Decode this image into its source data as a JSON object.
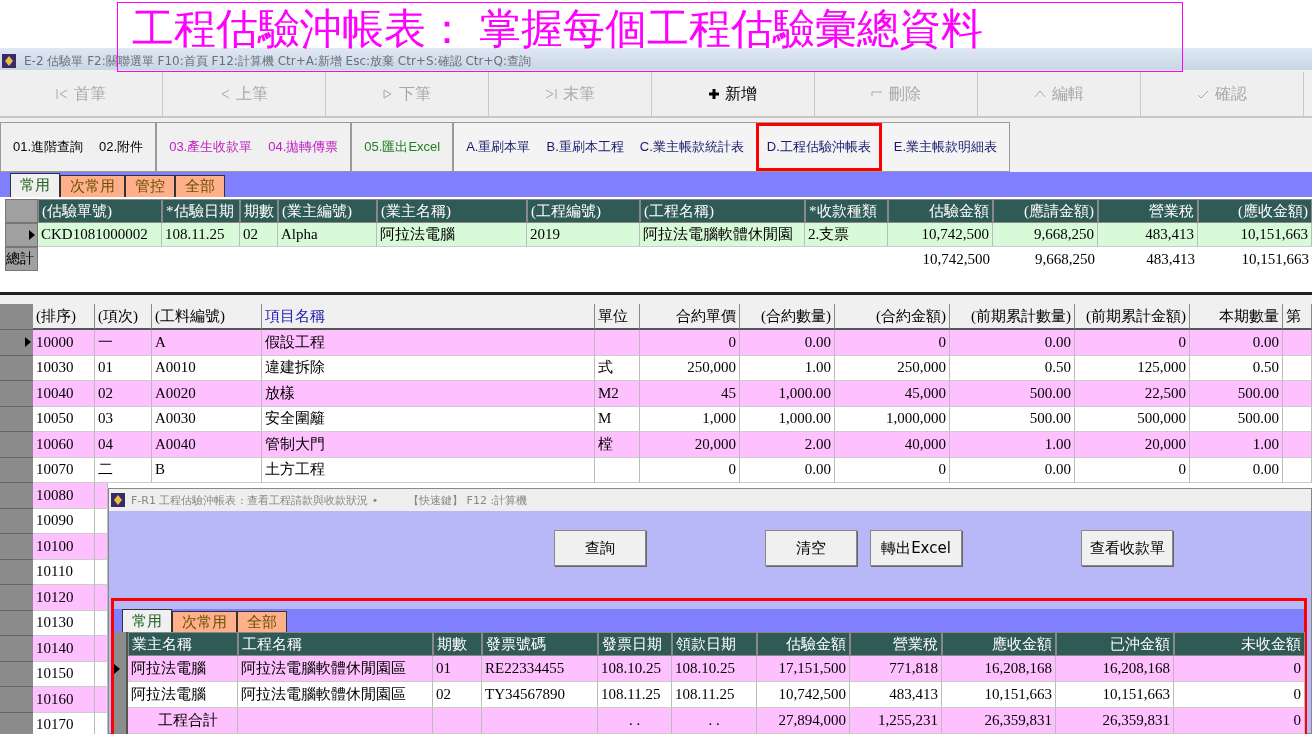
{
  "banner": {
    "title": "工程估驗沖帳表： 掌握每個工程估驗彙總資料"
  },
  "window": {
    "title": "E-2 估驗單 F2:關聯選單 F10:首頁 F12:計算機 Ctr+A:新增 Esc:放棄 Ctr+S:確認 Ctr+Q:查詢"
  },
  "toolbar": [
    {
      "label": "首筆",
      "kind": "first",
      "disabled": true
    },
    {
      "label": "上筆",
      "kind": "prev",
      "disabled": true
    },
    {
      "label": "下筆",
      "kind": "next",
      "disabled": true
    },
    {
      "label": "末筆",
      "kind": "last",
      "disabled": true
    },
    {
      "label": "新增",
      "kind": "add",
      "disabled": false
    },
    {
      "label": "刪除",
      "kind": "delete",
      "disabled": true
    },
    {
      "label": "編輯",
      "kind": "edit",
      "disabled": true
    },
    {
      "label": "確認",
      "kind": "confirm",
      "disabled": true
    }
  ],
  "actions": [
    {
      "items": [
        {
          "label": "01.進階查詢",
          "color": "#000000",
          "highlighted": false
        },
        {
          "label": "02.附件",
          "color": "#000000",
          "highlighted": false
        }
      ]
    },
    {
      "items": [
        {
          "label": "03.產生收款單",
          "color": "#c020c0",
          "highlighted": false
        },
        {
          "label": "04.拋轉傳票",
          "color": "#c020c0",
          "highlighted": false
        }
      ]
    },
    {
      "items": [
        {
          "label": "05.匯出Excel",
          "color": "#208020",
          "highlighted": false
        }
      ]
    },
    {
      "items": [
        {
          "label": "A.重刷本單",
          "color": "#1a1a6e",
          "highlighted": false
        },
        {
          "label": "B.重刷本工程",
          "color": "#1a1a6e",
          "highlighted": false
        },
        {
          "label": "C.業主帳款統計表",
          "color": "#1a1a6e",
          "highlighted": false
        },
        {
          "label": "D.工程估驗沖帳表",
          "color": "#1a1a6e",
          "highlighted": true
        },
        {
          "label": "E.業主帳款明細表",
          "color": "#1a1a6e",
          "highlighted": false
        }
      ]
    }
  ],
  "tabs": [
    {
      "label": "常用",
      "selected": true
    },
    {
      "label": "次常用",
      "selected": false
    },
    {
      "label": "管控",
      "selected": false
    },
    {
      "label": "全部",
      "selected": false
    }
  ],
  "upper_grid": {
    "columns": [
      "(估驗單號)",
      "*估驗日期",
      "期數",
      "(業主編號)",
      "(業主名稱)",
      "(工程編號)",
      "(工程名稱)",
      "*收款種類",
      "估驗金額",
      "(應請金額)",
      "營業稅",
      "(應收金額)"
    ],
    "rows": [
      {
        "current": true,
        "cells": [
          "CKD1081000002",
          "108.11.25",
          "02",
          "Alpha",
          "阿拉法電腦",
          "2019",
          "阿拉法電腦軟體休閒園",
          "2.支票",
          "10,742,500",
          "9,668,250",
          "483,413",
          "10,151,663"
        ]
      }
    ],
    "totals": {
      "label": "總計",
      "amounts": [
        "10,742,500",
        "9,668,250",
        "483,413",
        "10,151,663"
      ]
    }
  },
  "lower_grid": {
    "columns": [
      {
        "label": "(排序)",
        "emphasis": false
      },
      {
        "label": "(項次)",
        "emphasis": false
      },
      {
        "label": "(工料編號)",
        "emphasis": false
      },
      {
        "label": "項目名稱",
        "emphasis": true
      },
      {
        "label": "單位",
        "emphasis": false
      },
      {
        "label": "合約單價",
        "emphasis": false
      },
      {
        "label": "(合約數量)",
        "emphasis": false
      },
      {
        "label": "(合約金額)",
        "emphasis": false
      },
      {
        "label": "(前期累計數量)",
        "emphasis": false
      },
      {
        "label": "(前期累計金額)",
        "emphasis": false
      },
      {
        "label": "本期數量",
        "emphasis": false
      },
      {
        "label": "第",
        "emphasis": false
      }
    ],
    "rows": [
      {
        "current": true,
        "cells": [
          "10000",
          "一",
          "A",
          "假設工程",
          null,
          "0",
          "0.00",
          "0",
          "0.00",
          "0",
          "0.00"
        ]
      },
      {
        "current": false,
        "cells": [
          "10030",
          "01",
          "A0010",
          "違建拆除",
          "式",
          "250,000",
          "1.00",
          "250,000",
          "0.50",
          "125,000",
          "0.50"
        ]
      },
      {
        "current": false,
        "cells": [
          "10040",
          "02",
          "A0020",
          "放樣",
          "M2",
          "45",
          "1,000.00",
          "45,000",
          "500.00",
          "22,500",
          "500.00"
        ]
      },
      {
        "current": false,
        "cells": [
          "10050",
          "03",
          "A0030",
          "安全圍籬",
          "M",
          "1,000",
          "1,000.00",
          "1,000,000",
          "500.00",
          "500,000",
          "500.00"
        ]
      },
      {
        "current": false,
        "cells": [
          "10060",
          "04",
          "A0040",
          "管制大門",
          "樘",
          "20,000",
          "2.00",
          "40,000",
          "1.00",
          "20,000",
          "1.00"
        ]
      },
      {
        "current": false,
        "cells": [
          "10070",
          "二",
          "B",
          "土方工程",
          null,
          "0",
          "0.00",
          "0",
          "0.00",
          "0",
          "0.00"
        ]
      },
      {
        "current": false,
        "cells": [
          "10080"
        ]
      },
      {
        "current": false,
        "cells": [
          "10090"
        ]
      },
      {
        "current": false,
        "cells": [
          "10100"
        ]
      },
      {
        "current": false,
        "cells": [
          "10110"
        ]
      },
      {
        "current": false,
        "cells": [
          "10120"
        ]
      },
      {
        "current": false,
        "cells": [
          "10130"
        ]
      },
      {
        "current": false,
        "cells": [
          "10140"
        ]
      },
      {
        "current": false,
        "cells": [
          "10150"
        ]
      },
      {
        "current": false,
        "cells": [
          "10160"
        ]
      },
      {
        "current": false,
        "cells": [
          "10170"
        ]
      }
    ]
  },
  "popup": {
    "title": "F-R1 工程估驗沖帳表 : 查看工程請款與收款狀況 •",
    "hint": "【快速鍵】 F12 :計算機",
    "buttons": [
      "查詢",
      "清空",
      "轉出Excel",
      "查看收款單"
    ],
    "highlighted": true,
    "tabs": [
      {
        "label": "常用",
        "selected": true
      },
      {
        "label": "次常用",
        "selected": false
      },
      {
        "label": "全部",
        "selected": false
      }
    ],
    "columns": [
      "業主名稱",
      "工程名稱",
      "期數",
      "發票號碼",
      "發票日期",
      "領款日期",
      "估驗金額",
      "營業稅",
      "應收金額",
      "已沖金額",
      "未收金額"
    ],
    "rows": [
      {
        "current": true,
        "cells": [
          "阿拉法電腦",
          "阿拉法電腦軟體休閒園區",
          "01",
          "RE22334455",
          "108.10.25",
          "108.10.25",
          "17,151,500",
          "771,818",
          "16,208,168",
          "16,208,168",
          "0"
        ]
      },
      {
        "current": false,
        "cells": [
          "阿拉法電腦",
          "阿拉法電腦軟體休閒園區",
          "02",
          "TY34567890",
          "108.11.25",
          "108.11.25",
          "10,742,500",
          "483,413",
          "10,151,663",
          "10,151,663",
          "0"
        ]
      }
    ],
    "total": {
      "label": "工程合計",
      "cells": [
        null,
        null,
        null,
        ". .",
        ". .",
        "27,894,000",
        "1,255,231",
        "26,359,831",
        "26,359,831",
        "0"
      ]
    }
  }
}
